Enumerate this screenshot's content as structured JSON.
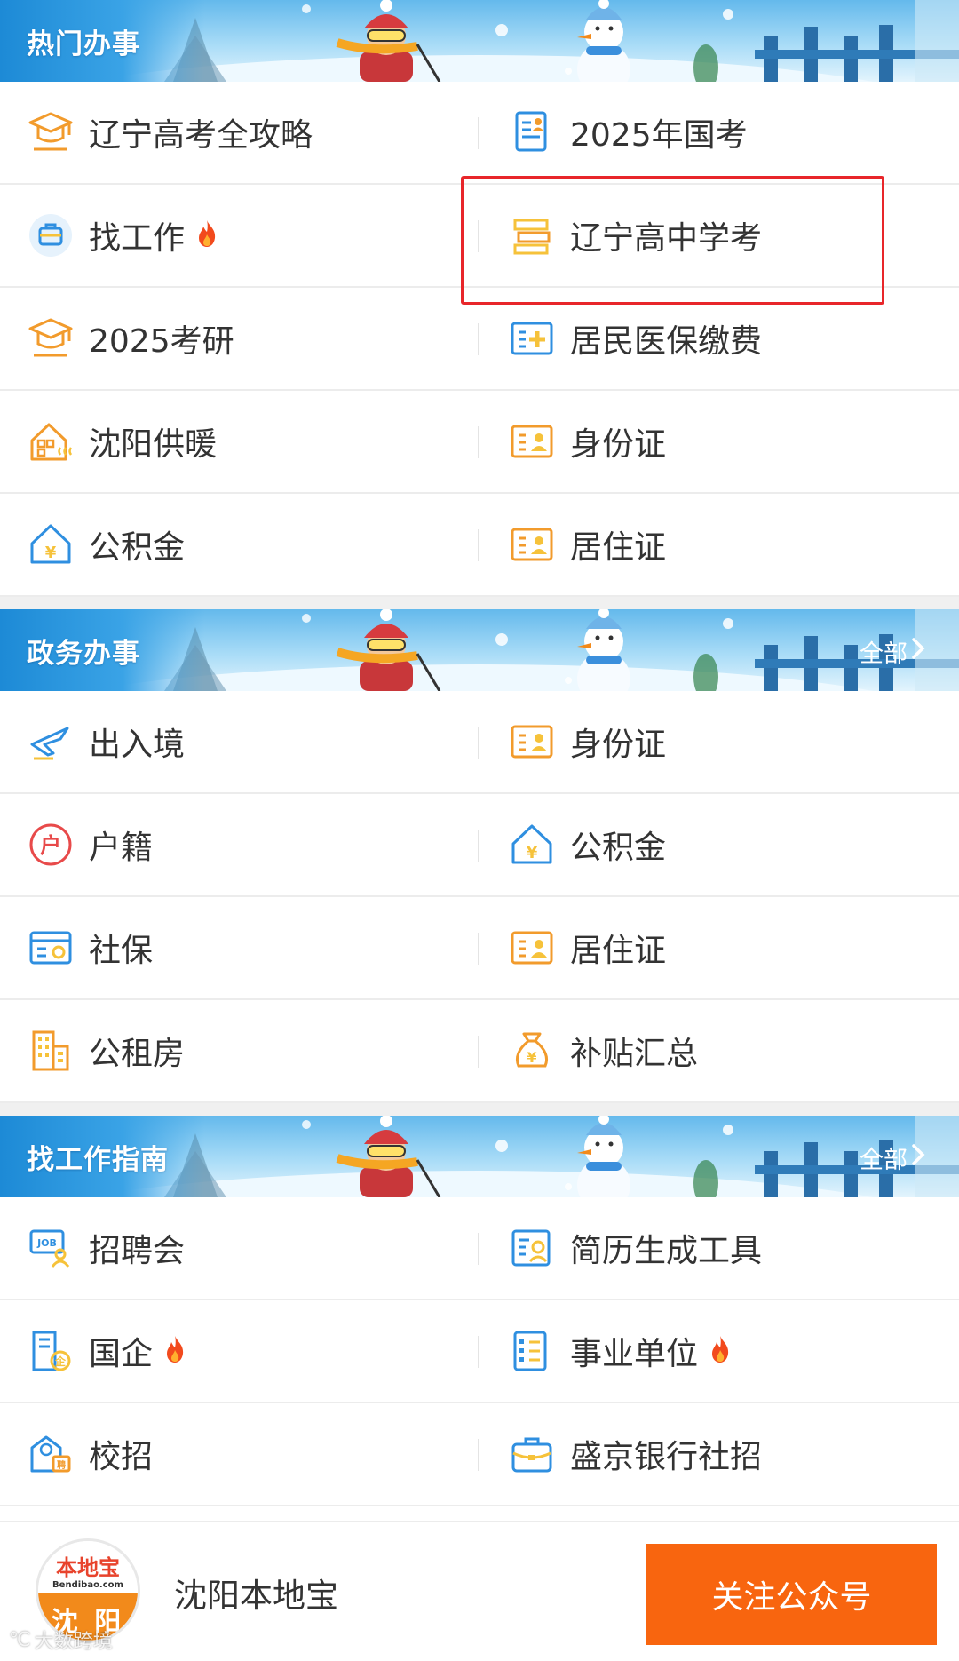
{
  "sections": [
    {
      "title": "热门办事",
      "more": "",
      "items": [
        {
          "label": "辽宁高考全攻略",
          "icon": "graduation-cap-icon",
          "fire": false
        },
        {
          "label": "2025年国考",
          "icon": "document-person-icon",
          "fire": false
        },
        {
          "label": "找工作",
          "icon": "briefcase-icon",
          "fire": true
        },
        {
          "label": "辽宁高中学考",
          "icon": "books-icon",
          "fire": false
        },
        {
          "label": "2025考研",
          "icon": "graduation-cap-icon",
          "fire": false
        },
        {
          "label": "居民医保缴费",
          "icon": "medical-card-icon",
          "fire": false
        },
        {
          "label": "沈阳供暖",
          "icon": "heating-house-icon",
          "fire": false
        },
        {
          "label": "身份证",
          "icon": "id-card-icon",
          "fire": false
        },
        {
          "label": "公积金",
          "icon": "house-yuan-icon",
          "fire": false
        },
        {
          "label": "居住证",
          "icon": "id-card-icon",
          "fire": false
        }
      ]
    },
    {
      "title": "政务办事",
      "more": "全部",
      "items": [
        {
          "label": "出入境",
          "icon": "airplane-icon",
          "fire": false
        },
        {
          "label": "身份证",
          "icon": "id-card-icon",
          "fire": false
        },
        {
          "label": "户籍",
          "icon": "household-icon",
          "fire": false
        },
        {
          "label": "公积金",
          "icon": "house-yuan-icon",
          "fire": false
        },
        {
          "label": "社保",
          "icon": "social-security-card-icon",
          "fire": false
        },
        {
          "label": "居住证",
          "icon": "id-card-icon",
          "fire": false
        },
        {
          "label": "公租房",
          "icon": "building-icon",
          "fire": false
        },
        {
          "label": "补贴汇总",
          "icon": "money-bag-icon",
          "fire": false
        }
      ]
    },
    {
      "title": "找工作指南",
      "more": "全部",
      "items": [
        {
          "label": "招聘会",
          "icon": "job-fair-icon",
          "fire": false
        },
        {
          "label": "简历生成工具",
          "icon": "resume-icon",
          "fire": false
        },
        {
          "label": "国企",
          "icon": "state-enterprise-icon",
          "fire": true
        },
        {
          "label": "事业单位",
          "icon": "institution-icon",
          "fire": true
        },
        {
          "label": "校招",
          "icon": "campus-recruit-icon",
          "fire": false
        },
        {
          "label": "盛京银行社招",
          "icon": "bank-briefcase-icon",
          "fire": false
        }
      ]
    }
  ],
  "footer": {
    "logo_cn": "本地宝",
    "logo_en": "Bendibao.com",
    "logo_city": "沈 阳",
    "account_name": "沈阳本地宝",
    "follow_label": "关注公众号",
    "watermark": "大数跨境"
  },
  "colors": {
    "accent_orange": "#f8650f",
    "icon_orange": "#f29b2c",
    "icon_blue": "#2f8fe0",
    "highlight_red": "#e8262a",
    "banner_blue": "#3aa3e6"
  }
}
